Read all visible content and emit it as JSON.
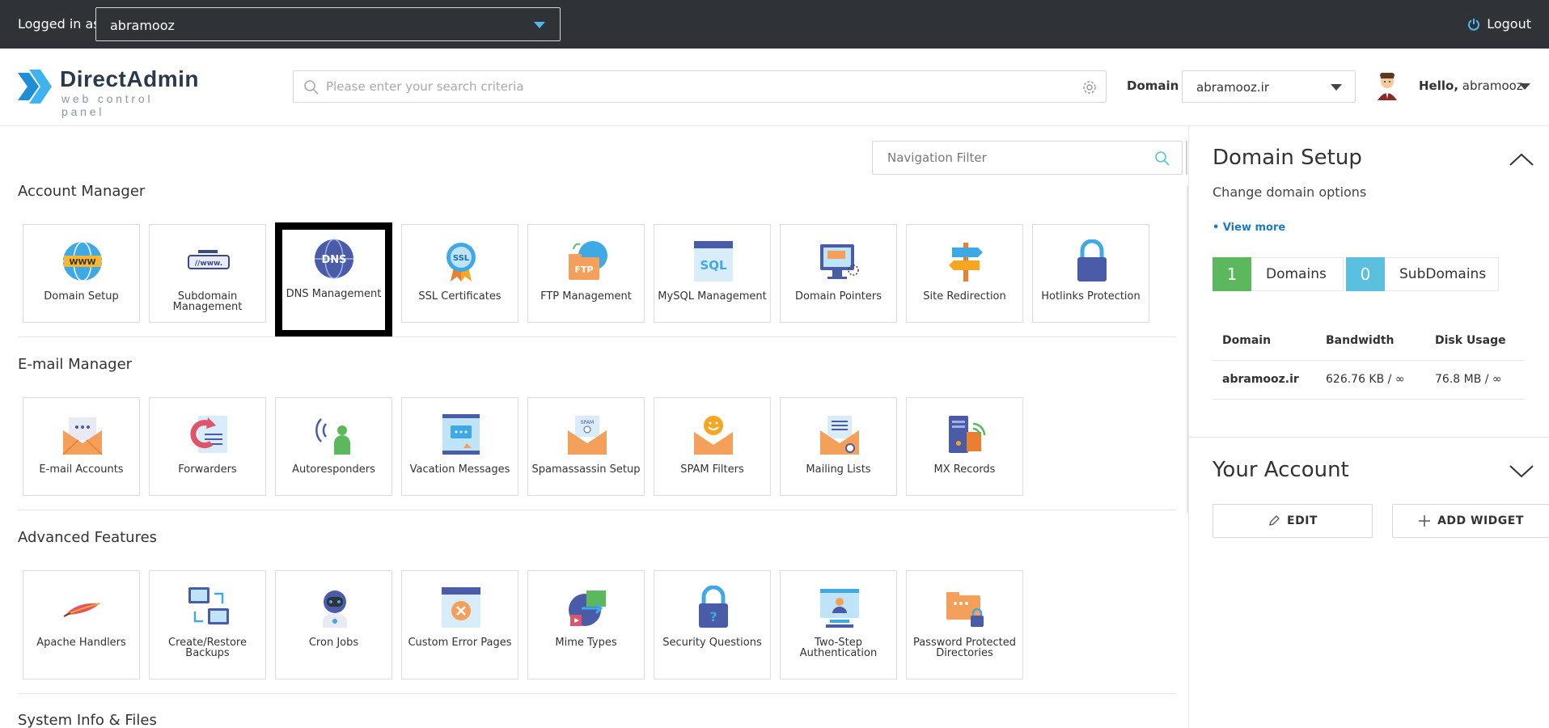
{
  "topbar": {
    "logged_in_label": "Logged in as",
    "user": "abramooz",
    "logout_label": "Logout"
  },
  "header": {
    "logo_name": "DirectAdmin",
    "logo_tagline": "web control panel",
    "search_placeholder": "Please enter your search criteria",
    "domain_label": "Domain",
    "domain_value": "abramooz.ir",
    "hello_prefix": "Hello,",
    "hello_user": "abramooz"
  },
  "main": {
    "nav_filter_placeholder": "Navigation Filter",
    "sections": [
      {
        "title": "Account Manager",
        "items": [
          {
            "label": "Domain Setup",
            "icon": "www-globe-icon"
          },
          {
            "label": "Subdomain Management",
            "icon": "subdomain-icon"
          },
          {
            "label": "DNS Management",
            "icon": "dns-globe-icon"
          },
          {
            "label": "SSL Certificates",
            "icon": "ssl-badge-icon"
          },
          {
            "label": "FTP Management",
            "icon": "ftp-folder-icon"
          },
          {
            "label": "MySQL Management",
            "icon": "sql-icon"
          },
          {
            "label": "Domain Pointers",
            "icon": "monitor-pointer-icon"
          },
          {
            "label": "Site Redirection",
            "icon": "signpost-icon"
          },
          {
            "label": "Hotlinks Protection",
            "icon": "lock-icon"
          }
        ]
      },
      {
        "title": "E-mail Manager",
        "items": [
          {
            "label": "E-mail Accounts",
            "icon": "envelope-icon"
          },
          {
            "label": "Forwarders",
            "icon": "forward-doc-icon"
          },
          {
            "label": "Autoresponders",
            "icon": "person-signal-icon"
          },
          {
            "label": "Vacation Messages",
            "icon": "message-board-icon"
          },
          {
            "label": "Spamassassin Setup",
            "icon": "spam-envelope-icon"
          },
          {
            "label": "SPAM Filters",
            "icon": "smile-envelope-icon"
          },
          {
            "label": "Mailing Lists",
            "icon": "list-envelope-icon"
          },
          {
            "label": "MX Records",
            "icon": "server-signal-icon"
          }
        ]
      },
      {
        "title": "Advanced Features",
        "items": [
          {
            "label": "Apache Handlers",
            "icon": "feather-icon"
          },
          {
            "label": "Create/Restore Backups",
            "icon": "backup-monitors-icon"
          },
          {
            "label": "Cron Jobs",
            "icon": "robot-icon"
          },
          {
            "label": "Custom Error Pages",
            "icon": "error-page-icon"
          },
          {
            "label": "Mime Types",
            "icon": "mime-globe-icon"
          },
          {
            "label": "Security Questions",
            "icon": "question-lock-icon"
          },
          {
            "label": "Two-Step Authentication",
            "icon": "auth-screen-icon"
          },
          {
            "label": "Password Protected Directories",
            "icon": "folder-lock-icon"
          }
        ]
      },
      {
        "title": "System Info & Files",
        "items": []
      }
    ]
  },
  "right_panel": {
    "domain_setup": {
      "title": "Domain Setup",
      "subtitle": "Change domain options",
      "view_more": "• View more",
      "domains_count": "1",
      "domains_label": "Domains",
      "subdomains_count": "0",
      "subdomains_label": "SubDomains",
      "table": {
        "headers": [
          "Domain",
          "Bandwidth",
          "Disk Usage"
        ],
        "rows": [
          [
            "abramooz.ir",
            "626.76 KB / ∞",
            "76.8 MB / ∞"
          ]
        ]
      }
    },
    "your_account": {
      "title": "Your Account",
      "edit_label": "EDIT",
      "add_widget_label": "ADD WIDGET"
    }
  },
  "colors": {
    "topbar_bg": "#2f3237",
    "accent_blue": "#4fb8f0",
    "domains_badge": "#5cb85c",
    "subdomains_badge": "#5bc0de",
    "link_blue": "#1c7bbf"
  }
}
